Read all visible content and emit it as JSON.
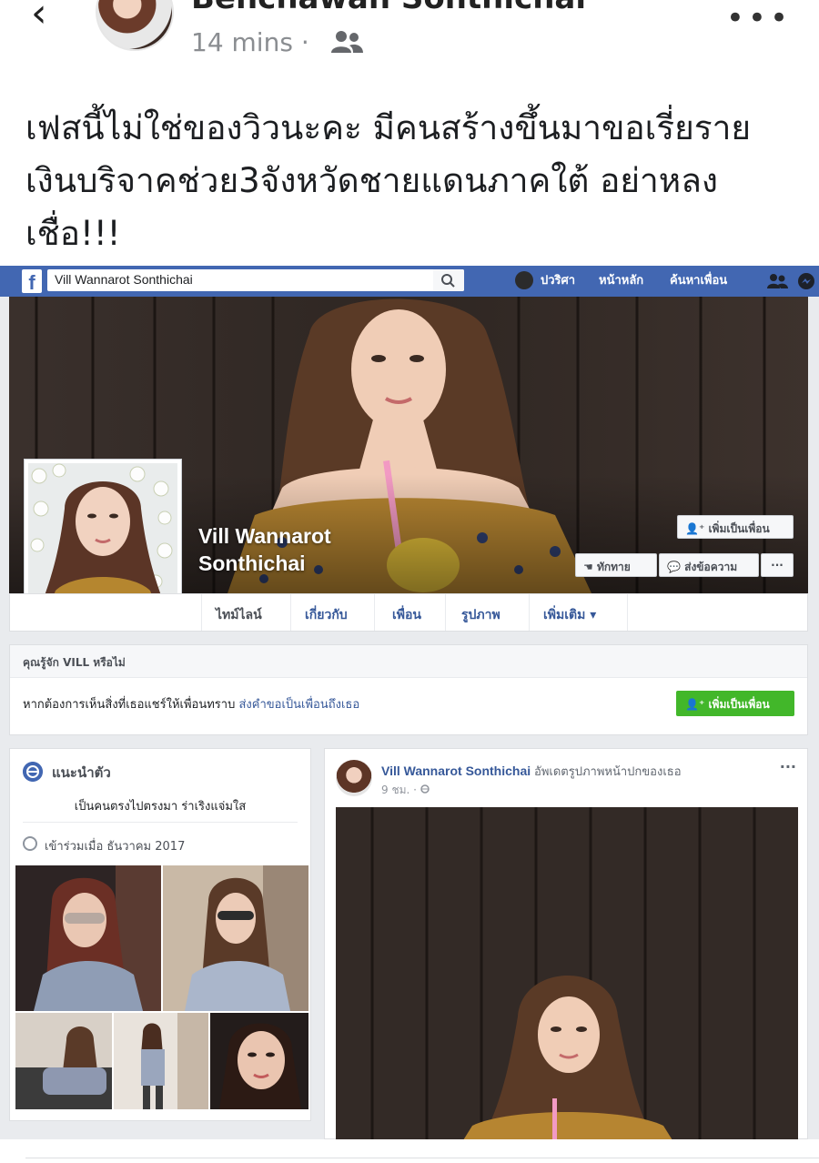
{
  "post": {
    "author": "Benchawan Sonthichai",
    "time": "14 mins",
    "separator": "·",
    "audience_icon": "friends-icon",
    "more_label": "•••",
    "back_label": "‹",
    "caption": "เฟสนี้ไม่ใช่ของวิวนะคะ มีคนสร้างขึ้นมาขอเรี่ยรายเงินบริจาคช่วย3จังหวัดชายแดนภาคใต้ อย่าหลงเชื่อ!!!"
  },
  "embedded": {
    "topbar": {
      "logo": "f",
      "search_value": "Vill Wannarot Sonthichai",
      "user_name": "ปวริศา",
      "home_label": "หน้าหลัก",
      "find_friends_label": "ค้นหาเพื่อน",
      "brand_color": "#4267b2"
    },
    "profile": {
      "name_line1": "Vill Wannarot",
      "name_line2": "Sonthichai",
      "add_friend_label": "เพิ่มเป็นเพื่อน",
      "poke_label": "ทักทาย",
      "message_label": "ส่งข้อความ",
      "more_label": "···"
    },
    "tabs": [
      {
        "label": "ไทม์ไลน์"
      },
      {
        "label": "เกี่ยวกับ"
      },
      {
        "label": "เพื่อน"
      },
      {
        "label": "รูปภาพ"
      },
      {
        "label": "เพิ่มเติม ▾"
      }
    ],
    "know": {
      "title": "คุณรู้จัก VILL หรือไม่",
      "text": "หากต้องการเห็นสิ่งที่เธอแชร์ให้เพื่อนทราบ",
      "link": "ส่งคำขอเป็นเพื่อนถึงเธอ",
      "button": "เพิ่มเป็นเพื่อน",
      "button_color": "#42b72a"
    },
    "intro": {
      "title": "แนะนำตัว",
      "bio": "เป็นคนตรงไปตรงมา ร่าเริงแจ่มใส",
      "joined": "เข้าร่วมเมื่อ ธันวาคม 2017"
    },
    "feed_post": {
      "author": "Vill Wannarot Sonthichai",
      "action": "อัพเดตรูปภาพหน้าปกของเธอ",
      "time": "9 ชม. · ",
      "globe_icon": "globe-icon",
      "more_label": "···"
    }
  }
}
